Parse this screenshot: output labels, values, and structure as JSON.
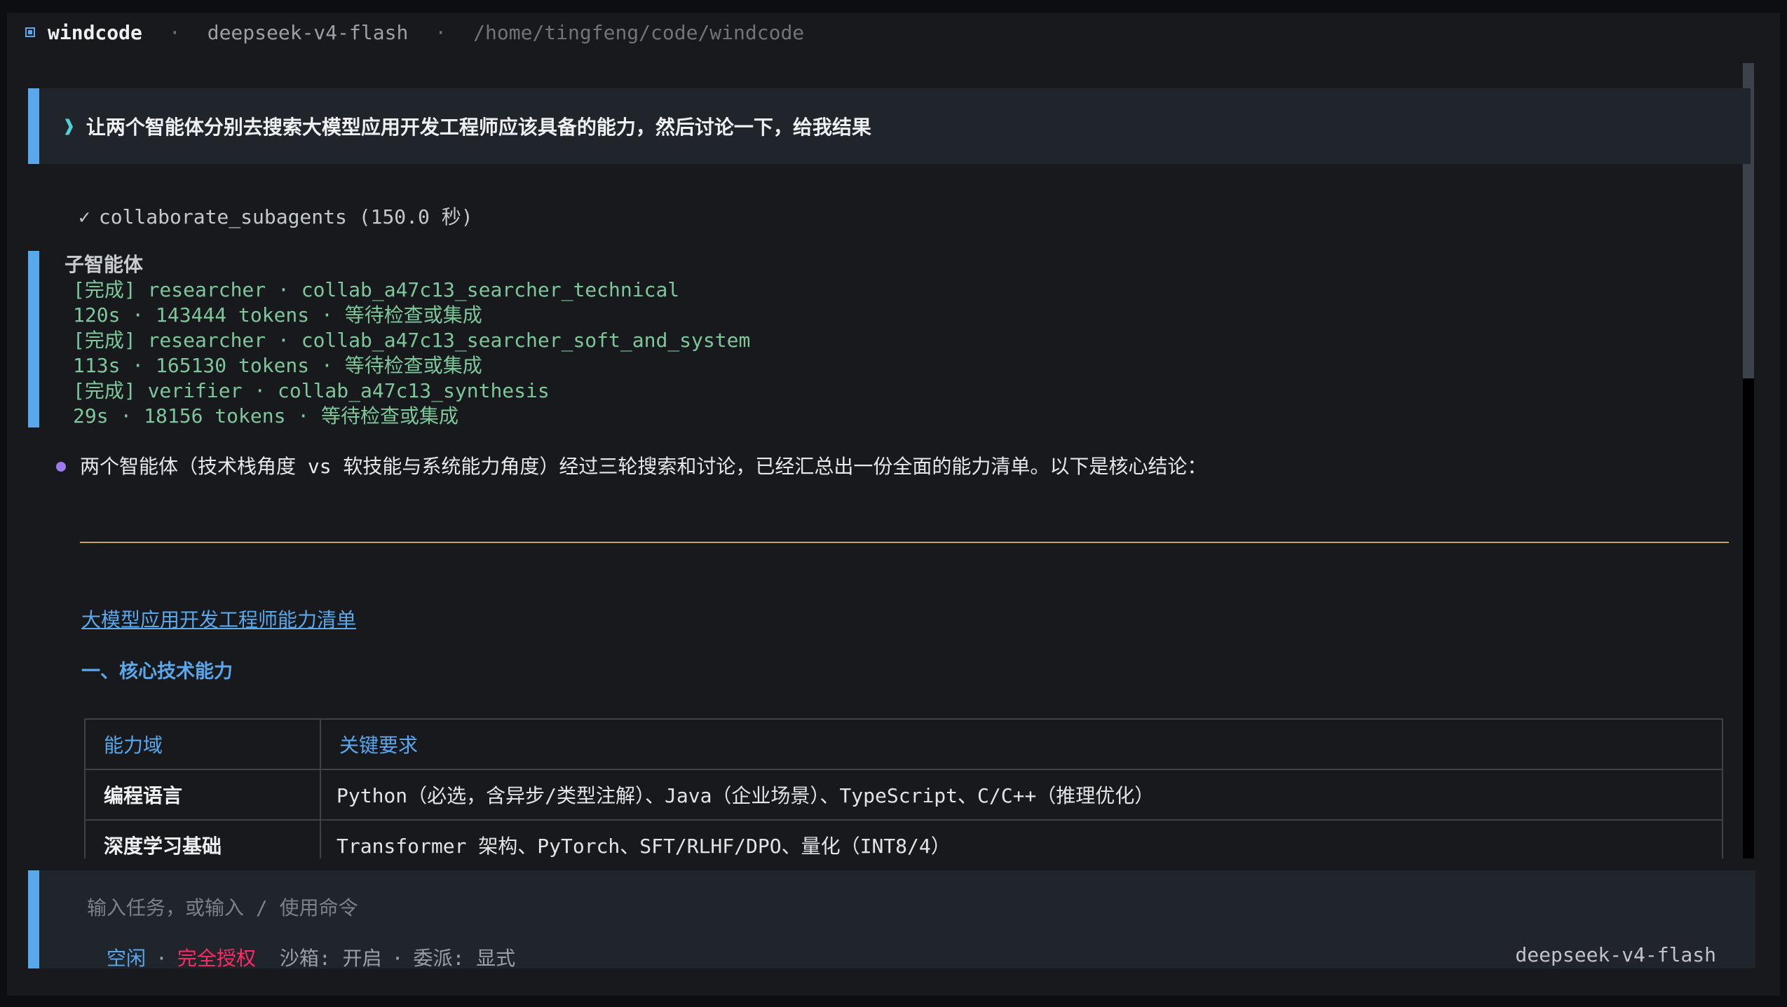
{
  "titlebar": {
    "icon": "window-icon",
    "app": "windcode",
    "sep": "·",
    "model": "deepseek-v4-flash",
    "path": "/home/tingfeng/code/windcode"
  },
  "prompt": {
    "chevron": "❱",
    "text": "让两个智能体分别去搜索大模型应用开发工程师应该具备的能力，然后讨论一下，给我结果"
  },
  "tool": {
    "check": "✓",
    "text": "collaborate_subagents (150.0 秒)"
  },
  "subagents": {
    "title": "子智能体",
    "lines": [
      "[完成] researcher · collab_a47c13_searcher_technical",
      "120s · 143444 tokens · 等待检查或集成",
      "[完成] researcher · collab_a47c13_searcher_soft_and_system",
      "113s · 165130 tokens · 等待检查或集成",
      "[完成] verifier · collab_a47c13_synthesis",
      "29s · 18156 tokens · 等待检查或集成"
    ]
  },
  "assistant": {
    "text": "两个智能体（技术栈角度 vs 软技能与系统能力角度）经过三轮搜索和讨论，已经汇总出一份全面的能力清单。以下是核心结论："
  },
  "doc": {
    "title": "大模型应用开发工程师能力清单",
    "section1": "一、核心技术能力",
    "table": {
      "headers": [
        "能力域",
        "关键要求"
      ],
      "rows": [
        [
          "编程语言",
          "Python（必选，含异步/类型注解）、Java（企业场景）、TypeScript、C/C++（推理优化）"
        ],
        [
          "深度学习基础",
          "Transformer 架构、PyTorch、SFT/RLHF/DPO、量化（INT8/4）"
        ]
      ]
    }
  },
  "input": {
    "placeholder": "输入任务，或输入 / 使用命令",
    "status_idle": "空闲",
    "status_full": "完全授权",
    "dot": "·",
    "sandbox": "沙箱: 开启",
    "delegate": "委派: 显式",
    "model": "deepseek-v4-flash"
  },
  "colors": {
    "accent": "#5aa8ec",
    "success": "#7ec79a",
    "danger": "#ff2a66",
    "rule": "#c8a35c",
    "bullet": "#9b7cf0"
  },
  "scroll_position": 0
}
